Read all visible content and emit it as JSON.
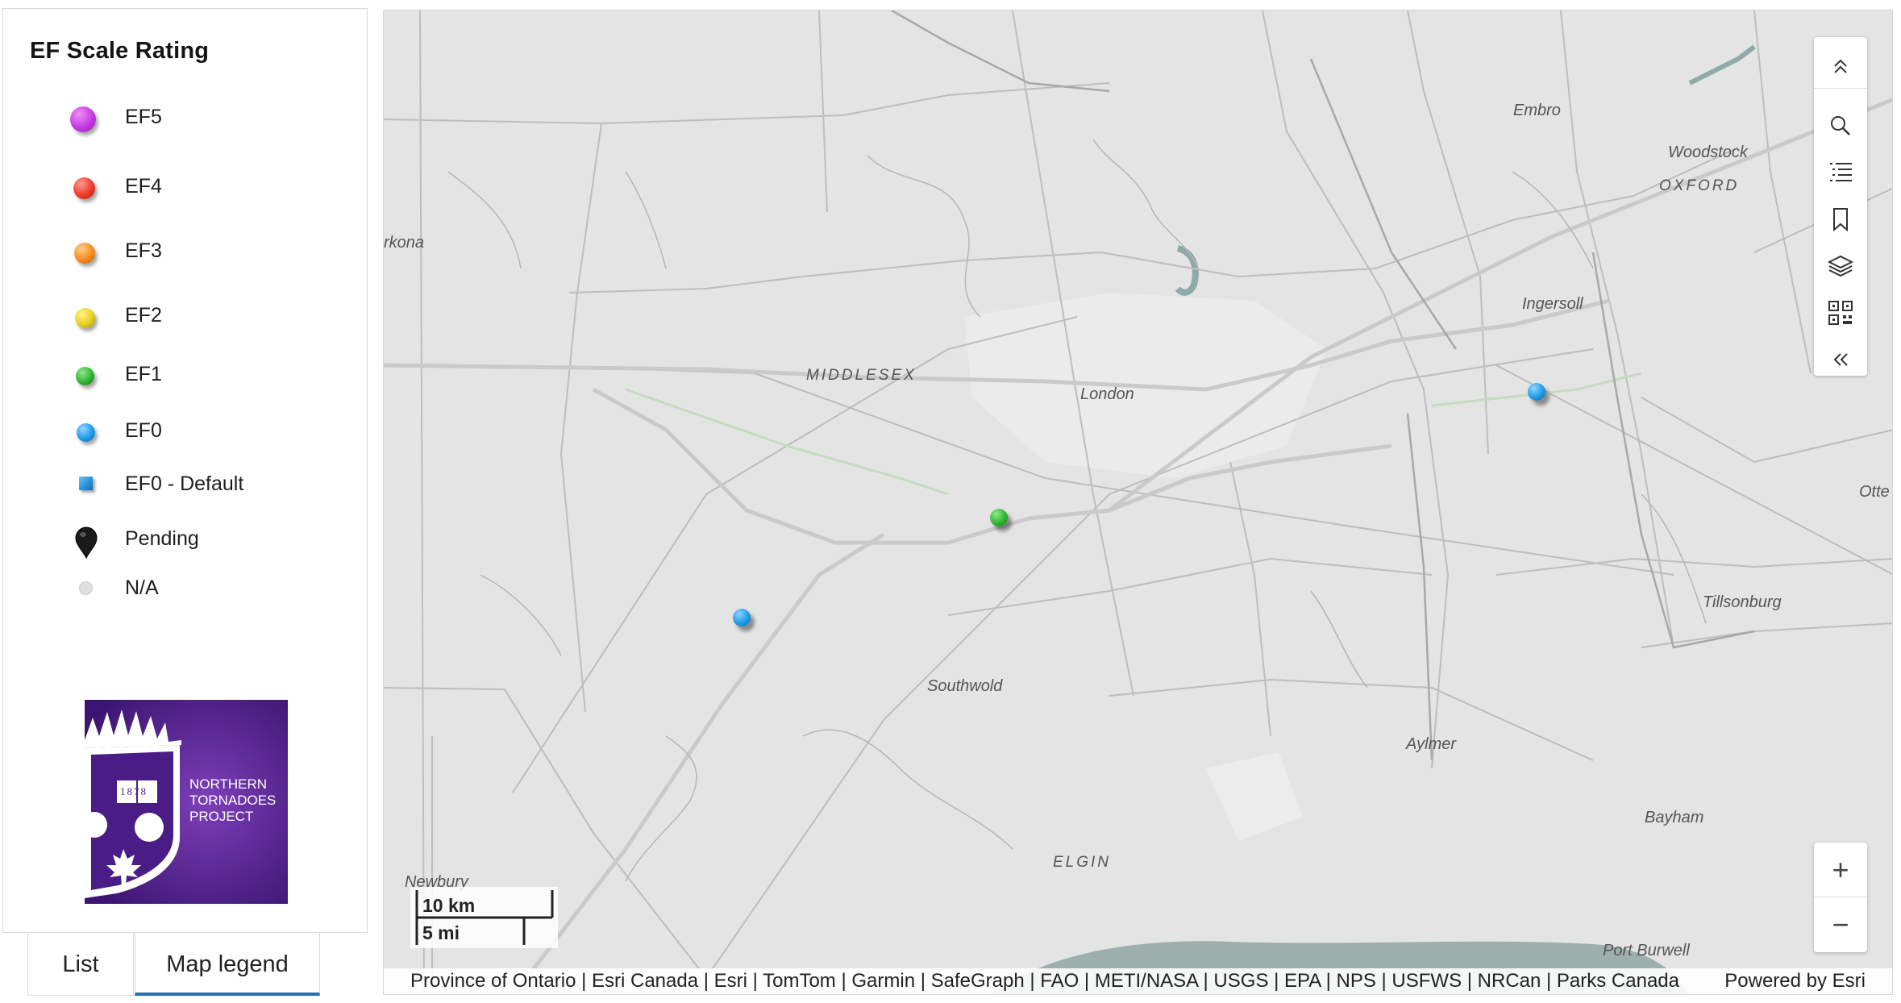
{
  "legend": {
    "title": "EF Scale Rating",
    "items": [
      {
        "label": "EF5",
        "symbol": "circle",
        "color": "#c23be0"
      },
      {
        "label": "EF4",
        "symbol": "circle",
        "color": "#ee3b2b"
      },
      {
        "label": "EF3",
        "symbol": "circle",
        "color": "#f58c1e"
      },
      {
        "label": "EF2",
        "symbol": "circle",
        "color": "#e8cf1f"
      },
      {
        "label": "EF1",
        "symbol": "circle",
        "color": "#2fb52f"
      },
      {
        "label": "EF0",
        "symbol": "circle",
        "color": "#1e9be8"
      },
      {
        "label": "EF0 - Default",
        "symbol": "square",
        "color": "#2891d8"
      },
      {
        "label": "Pending",
        "symbol": "pin",
        "color": "#1a1a1a"
      },
      {
        "label": "N/A",
        "symbol": "dot",
        "color": "#d8d8d8"
      }
    ],
    "logo_text": [
      "NORTHERN",
      "TORNADOES",
      "PROJECT"
    ],
    "logo_year": "1878"
  },
  "tabs": [
    {
      "label": "List",
      "active": false
    },
    {
      "label": "Map legend",
      "active": true
    }
  ],
  "map": {
    "labels": {
      "embro": "Embro",
      "woodstock": "Woodstock",
      "oxford": "OXFORD",
      "arkona": "rkona",
      "ingersoll": "Ingersoll",
      "middlesex": "MIDDLESEX",
      "london": "London",
      "otter": "Otte",
      "tillsonburg": "Tillsonburg",
      "southwold": "Southwold",
      "aylmer": "Aylmer",
      "bayham": "Bayham",
      "elgin": "ELGIN",
      "newbury": "Newbury",
      "port_burwell": "Port Burwell"
    },
    "markers": [
      {
        "rating": "EF0",
        "color": "#1e9be8"
      },
      {
        "rating": "EF1",
        "color": "#2fb52f"
      },
      {
        "rating": "EF0",
        "color": "#1e9be8"
      }
    ],
    "toolbar": [
      "collapse-up-icon",
      "search-icon",
      "layer-list-icon",
      "bookmark-icon",
      "layers-icon",
      "qr-code-icon",
      "collapse-left-icon"
    ],
    "zoom_in": "+",
    "zoom_out": "−",
    "scale_km": "10 km",
    "scale_mi": "5 mi",
    "attribution": "Province of Ontario | Esri Canada | Esri | TomTom | Garmin | SafeGraph | FAO | METI/NASA | USGS | EPA | NPS | USFWS | NRCan | Parks Canada",
    "powered_by": "Powered by Esri"
  }
}
